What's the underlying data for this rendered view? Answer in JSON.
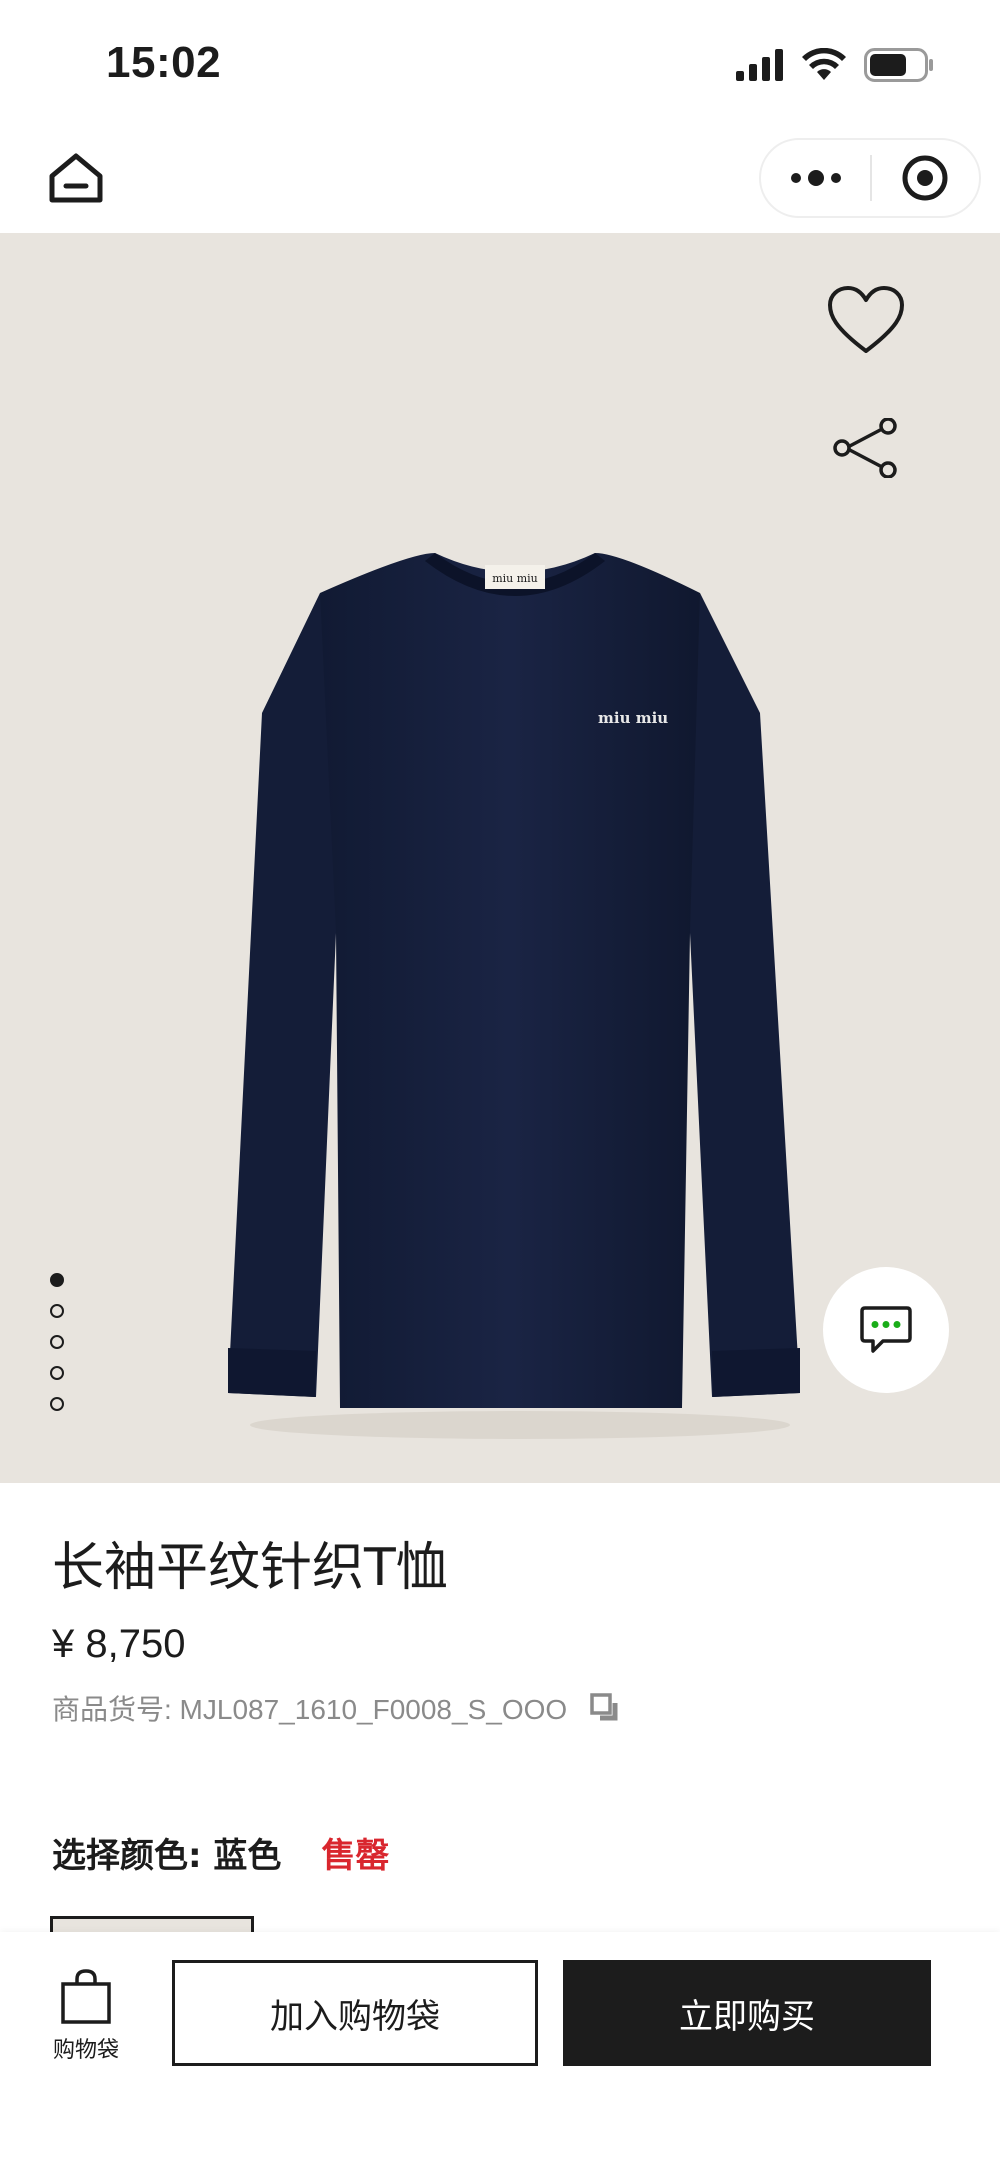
{
  "status_bar": {
    "time": "15:02",
    "icons": [
      "signal-icon",
      "wifi-icon",
      "battery-icon"
    ]
  },
  "nav": {
    "icons": [
      "home-icon",
      "more-icon",
      "close-target-icon"
    ]
  },
  "hero": {
    "background_color": "#e8e4de",
    "product_image": "navy long-sleeve t-shirt",
    "brand_label": "miu miu",
    "page_dots": {
      "total": 5,
      "active_index": 0
    },
    "icons": [
      "heart-icon",
      "share-icon",
      "chat-icon"
    ]
  },
  "product": {
    "title": "长袖平纹针织T恤",
    "price": "¥ 8,750",
    "sku": "商品货号: MJL087_1610_F0008_S_OOO",
    "color_label": "选择颜色: 蓝色",
    "stock_status": "售罄",
    "stock_status_color": "#d9262e"
  },
  "bottom_bar": {
    "bag_label": "购物袋",
    "add_to_bag": "加入购物袋",
    "buy_now": "立即购买",
    "buy_button_color": "#1c1c1c"
  }
}
